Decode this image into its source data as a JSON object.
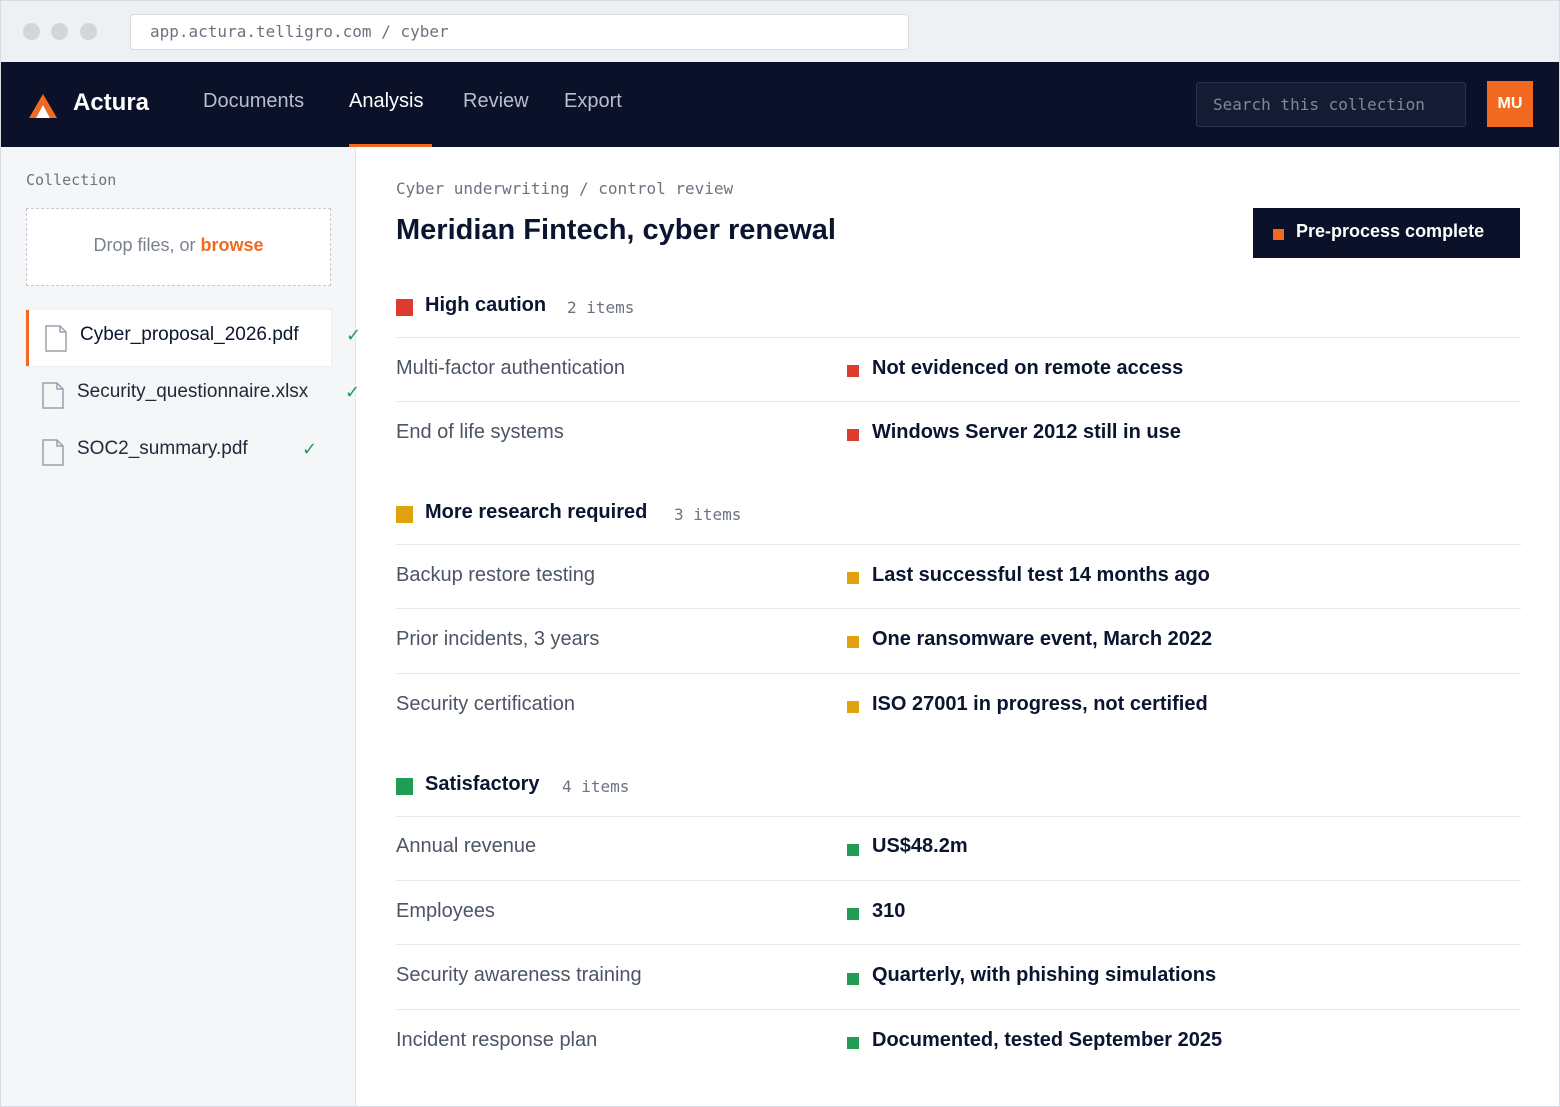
{
  "browser": {
    "url": "app.actura.telligro.com / cyber"
  },
  "header": {
    "brand": "Actura",
    "nav": [
      {
        "label": "Documents",
        "active": false
      },
      {
        "label": "Analysis",
        "active": true
      },
      {
        "label": "Review",
        "active": false
      },
      {
        "label": "Export",
        "active": false
      }
    ],
    "search_placeholder": "Search this collection",
    "avatar_initials": "MU"
  },
  "sidebar": {
    "title": "Collection",
    "dropzone_text": "Drop files, or ",
    "dropzone_link": "browse",
    "files": [
      {
        "name": "Cyber_proposal_2026.pdf",
        "status": "✓",
        "active": true
      },
      {
        "name": "Security_questionnaire.xlsx",
        "status": "✓",
        "active": false
      },
      {
        "name": "SOC2_summary.pdf",
        "status": "✓",
        "active": false
      }
    ]
  },
  "main": {
    "breadcrumb": "Cyber underwriting / control review",
    "title": "Meridian Fintech, cyber renewal",
    "status_button": "Pre-process complete",
    "sections": [
      {
        "label": "High caution",
        "count": "2 items",
        "color": "#dc3b2f",
        "rows": [
          {
            "label": "Multi-factor authentication",
            "value": "Not evidenced on remote access"
          },
          {
            "label": "End of life systems",
            "value": "Windows Server 2012 still in use"
          }
        ]
      },
      {
        "label": "More research required",
        "count": "3 items",
        "color": "#e0a20e",
        "rows": [
          {
            "label": "Backup restore testing",
            "value": "Last successful test 14 months ago"
          },
          {
            "label": "Prior incidents, 3 years",
            "value": "One ransomware event, March 2022"
          },
          {
            "label": "Security certification",
            "value": "ISO 27001 in progress, not certified"
          }
        ]
      },
      {
        "label": "Satisfactory",
        "count": "4 items",
        "color": "#1f9d55",
        "rows": [
          {
            "label": "Annual revenue",
            "value": "US$48.2m"
          },
          {
            "label": "Employees",
            "value": "310"
          },
          {
            "label": "Security awareness training",
            "value": "Quarterly, with phishing simulations"
          },
          {
            "label": "Incident response plan",
            "value": "Documented, tested September 2025"
          }
        ]
      }
    ]
  },
  "colors": {
    "accent": "#f26a21",
    "navy": "#0a1128"
  }
}
